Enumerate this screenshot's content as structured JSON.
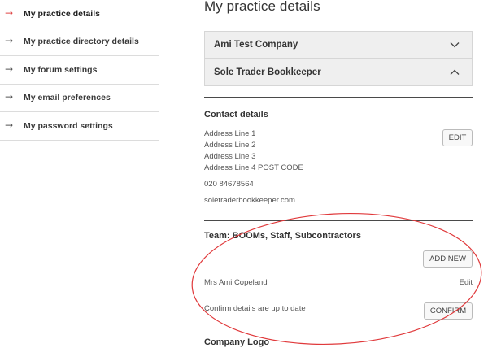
{
  "sidebar": {
    "items": [
      {
        "label": "My practice details",
        "active": true
      },
      {
        "label": "My practice directory details",
        "active": false
      },
      {
        "label": "My forum settings",
        "active": false
      },
      {
        "label": "My email preferences",
        "active": false
      },
      {
        "label": "My password settings",
        "active": false
      }
    ],
    "arrow_glyph": "→"
  },
  "main": {
    "title": "My practice details",
    "accordions": [
      {
        "label": "Ami Test Company",
        "state": "collapsed",
        "icon": "chevron-down-icon"
      },
      {
        "label": "Sole Trader Bookkeeper",
        "state": "expanded",
        "icon": "chevron-up-icon"
      }
    ],
    "contact": {
      "heading": "Contact details",
      "address": [
        "Address Line 1",
        "Address Line 2",
        "Address Line 3",
        "Address Line 4 POST CODE"
      ],
      "phone": "020 84678564",
      "website": "soletraderbookkeeper.com",
      "edit_label": "EDIT"
    },
    "team": {
      "heading": "Team: BOOMs, Staff, Subcontractors",
      "add_label": "ADD NEW",
      "member_name": "Mrs Ami Copeland",
      "member_edit": "Edit",
      "confirm_text": "Confirm details are up to date",
      "confirm_label": "CONFIRM"
    },
    "logo_heading": "Company Logo"
  },
  "colors": {
    "active_arrow": "#e04848",
    "annotation_oval": "#e0393b",
    "accordion_bg": "#efefef"
  }
}
